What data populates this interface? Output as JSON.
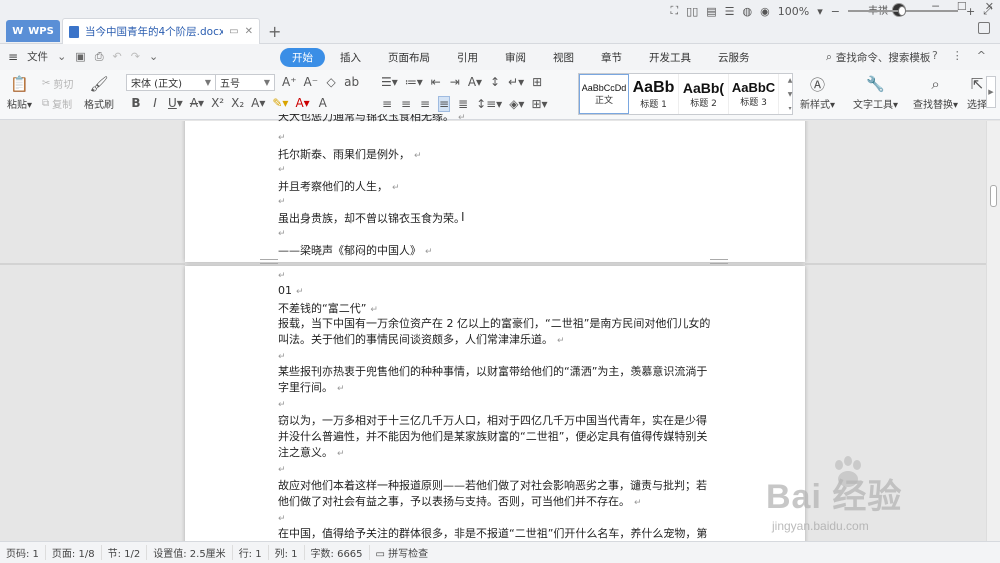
{
  "titlebar": {
    "app_tab": "WPS",
    "doc_tab": "当今中国青年的4个阶层.docx",
    "new_tab": "+",
    "user_name": "丰祺",
    "minimize": "─",
    "maximize": "☐",
    "close": "✕"
  },
  "menubar": {
    "file_label": "文件",
    "tabs": [
      "开始",
      "插入",
      "页面布局",
      "引用",
      "审阅",
      "视图",
      "章节",
      "开发工具",
      "云服务"
    ],
    "active_tab": "开始",
    "search_placeholder": "查找命令、搜索模板",
    "help": "?",
    "more": "⋮",
    "collapse": "^"
  },
  "ribbon": {
    "paste": "粘贴",
    "cut": "剪切",
    "copy": "复制",
    "format_painter": "格式刷",
    "font_name": "宋体 (正文)",
    "font_size": "五号",
    "styles": [
      {
        "preview": "AaBbCcDd",
        "label": "正文"
      },
      {
        "preview": "AaBb",
        "label": "标题 1"
      },
      {
        "preview": "AaBb(",
        "label": "标题 2"
      },
      {
        "preview": "AaBbC",
        "label": "标题 3"
      }
    ],
    "new_style": "新样式",
    "text_tools": "文字工具",
    "find_replace": "查找替换",
    "select": "选择"
  },
  "document": {
    "page1_lines": [
      "天大也惩力通常与锦衣玉食相无缘。",
      "托尔斯泰、雨果们是例外，",
      "并且考察他们的人生，",
      "虽出身贵族，却不曾以锦衣玉食为荣。",
      "——梁晓声《郁闷的中国人》"
    ],
    "page2": {
      "section_number": "01",
      "heading": "不差钱的“富二代”",
      "paragraphs": [
        "报载，当下中国有一万余位资产在 2 亿以上的富豪们，“二世祖”是南方民间对他们儿女的叫法。关于他们的事情民间谈资颇多，人们常津津乐道。",
        "某些报刊亦热衷于兜售他们的种种事情，以财富带给他们的“潇洒”为主，羡慕意识流淌于字里行间。",
        "窃以为，一万多相对于十三亿几千万人口，相对于四亿几千万中国当代青年，实在是少得并没什么普遍性，并不能因为他们是某家族财富的“二世祖”，便必定具有值得传媒特别关注之意义。",
        "故应对他们本着这样一种报道原则——若他们做了对社会影响恶劣之事，谴责与批判；若他们做了对社会有益之事，予以表扬与支持。否则，可当他们并不存在。",
        "在中国，值得给予关注的群体很多，非是不报道“二世祖”们开什么名车，养什么宠物，第"
      ]
    },
    "para_mark": "↵"
  },
  "watermark": {
    "main": "Bai 经验",
    "sub": "jingyan.baidu.com"
  },
  "statusbar": {
    "page_num": "页码: 1",
    "page_count": "页面: 1/8",
    "section": "节: 1/2",
    "setting": "设置值: 2.5厘米",
    "row": "行: 1",
    "col": "列: 1",
    "word_count": "字数: 6665",
    "spell_check": "拼写检查",
    "zoom": "100%",
    "zoom_value": 100
  }
}
